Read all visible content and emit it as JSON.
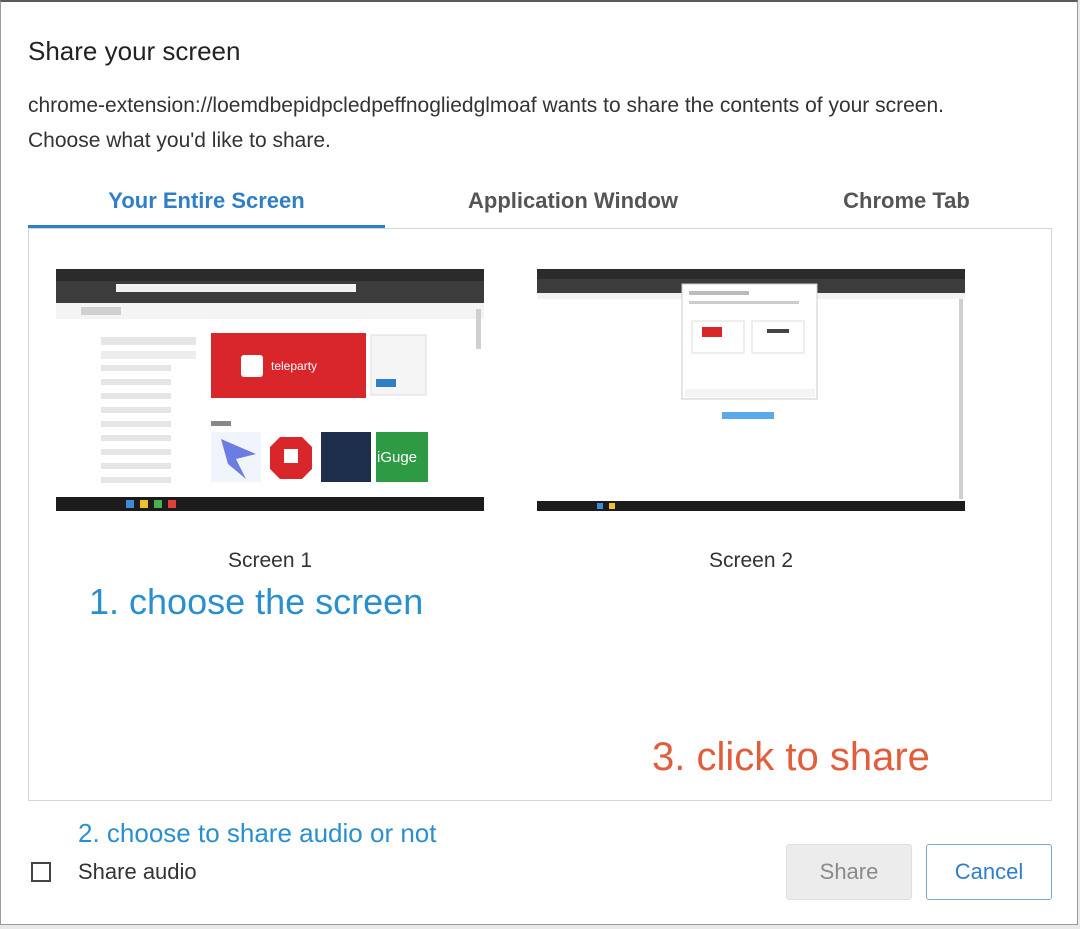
{
  "dialog": {
    "title": "Share your screen",
    "message": "chrome-extension://loemdbepidpcledpeffnogliedglmoaf wants to share the contents of your screen. Choose what you'd like to share."
  },
  "tabs": [
    {
      "label": "Your Entire Screen",
      "selected": true
    },
    {
      "label": "Application Window",
      "selected": false
    },
    {
      "label": "Chrome Tab",
      "selected": false
    }
  ],
  "screens": [
    {
      "label": "Screen 1",
      "thumb_text": {
        "brand": "teleparty",
        "icon_text": "iGuge"
      }
    },
    {
      "label": "Screen 2"
    }
  ],
  "annotations": {
    "step1": "1. choose the screen",
    "step2": "2. choose to share audio or not",
    "step3": "3. click to share"
  },
  "audio": {
    "label": "Share audio",
    "checked": false
  },
  "buttons": {
    "share": "Share",
    "cancel": "Cancel"
  },
  "colors": {
    "accent": "#2f7fc8",
    "annotation_blue": "#2a8fcf",
    "annotation_red": "#e25d3b",
    "teleparty_red": "#d9262b"
  }
}
